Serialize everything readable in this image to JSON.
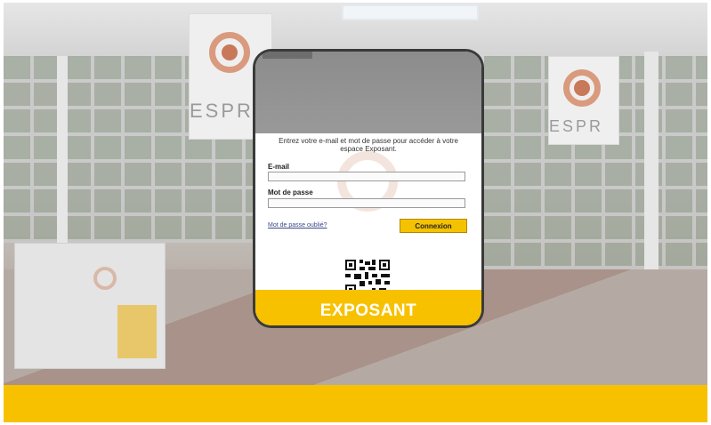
{
  "background": {
    "banner_word": "ESPR",
    "bottom_bar_color": "#f7c100"
  },
  "login": {
    "intro_text": "Entrez votre e-mail et mot de passe pour accéder à votre espace Exposant.",
    "email_label": "E-mail",
    "email_value": "",
    "password_label": "Mot de passe",
    "password_value": "",
    "forgot_link": "Mot de passe oublié?",
    "submit_label": "Connexion",
    "qr_icon": "qr-code-icon",
    "footer_label": "EXPOSANT",
    "accent_color": "#f7c100"
  }
}
